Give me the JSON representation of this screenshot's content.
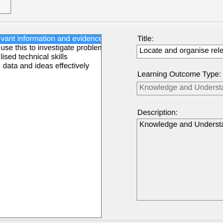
{
  "objective_list": {
    "items": [
      {
        "label": "vant information and evidence",
        "selected": true
      },
      {
        "label": "use this to investigate problems",
        "selected": false
      },
      {
        "label": "lised technical skills",
        "selected": false
      },
      {
        "label": " data and ideas effectively",
        "selected": false
      }
    ]
  },
  "details": {
    "title_label": "Title:",
    "title_value": "Locate and organise relevant",
    "type_label": "Learning Outcome Type:",
    "type_value": "Knowledge and Understanding",
    "description_label": "Description:",
    "description_value": "Knowledge and Understanding"
  }
}
